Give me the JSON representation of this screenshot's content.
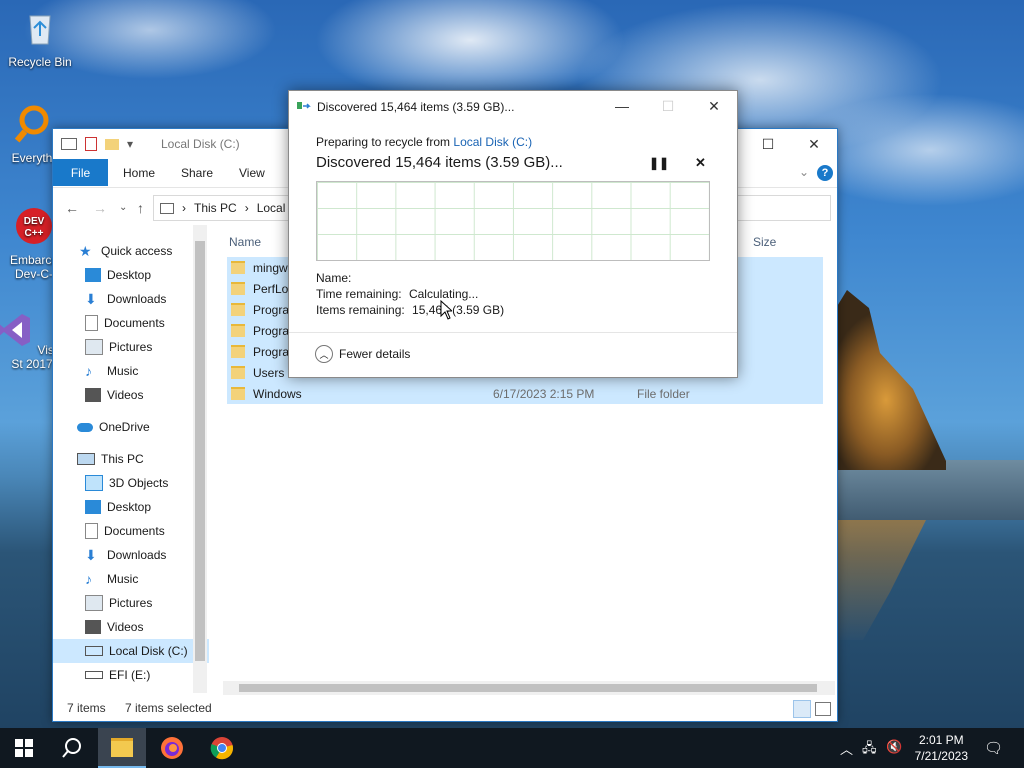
{
  "desktop": {
    "icons": [
      {
        "label": "Recycle Bin"
      },
      {
        "label": "Everyth"
      },
      {
        "label": "Embarca Dev-C-"
      },
      {
        "label": "Visual St 2017"
      }
    ]
  },
  "explorer": {
    "title": "Local Disk (C:)",
    "ribbon_tabs": [
      "File",
      "Home",
      "Share",
      "View"
    ],
    "breadcrumb": [
      "This PC",
      "Local"
    ],
    "sidebar": {
      "quick_access": "Quick access",
      "quick_items": [
        "Desktop",
        "Downloads",
        "Documents",
        "Pictures",
        "Music",
        "Videos"
      ],
      "onedrive": "OneDrive",
      "this_pc": "This PC",
      "pc_items": [
        "3D Objects",
        "Desktop",
        "Documents",
        "Downloads",
        "Music",
        "Pictures",
        "Videos",
        "Local Disk (C:)",
        "EFI (E:)"
      ]
    },
    "columns": {
      "name": "Name",
      "size": "Size"
    },
    "rows": [
      {
        "name": "mingw",
        "date": "",
        "type": ""
      },
      {
        "name": "PerfLog",
        "date": "",
        "type": ""
      },
      {
        "name": "Progra",
        "date": "",
        "type": ""
      },
      {
        "name": "Progra",
        "date": "",
        "type": ""
      },
      {
        "name": "Progra",
        "date": "",
        "type": ""
      },
      {
        "name": "Users",
        "date": "",
        "type": ""
      },
      {
        "name": "Windows",
        "date": "6/17/2023 2:15 PM",
        "type": "File folder"
      }
    ],
    "status": {
      "count": "7 items",
      "selected": "7 items selected"
    }
  },
  "dialog": {
    "title": "Discovered 15,464 items (3.59 GB)...",
    "preparing_prefix": "Preparing to recycle from",
    "preparing_link": "Local Disk (C:)",
    "headline": "Discovered 15,464 items (3.59 GB)...",
    "name_label": "Name:",
    "time_label": "Time remaining:",
    "time_value": "Calculating...",
    "items_label": "Items remaining:",
    "items_value": "15,464 (3.59 GB)",
    "fewer_details": "Fewer details"
  },
  "taskbar": {
    "time": "2:01 PM",
    "date": "7/21/2023"
  },
  "colors": {
    "accent": "#1979ca",
    "selection": "#cce8ff"
  }
}
